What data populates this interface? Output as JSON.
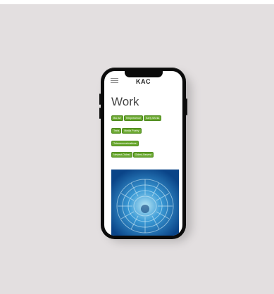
{
  "app": {
    "logo": "KAC"
  },
  "page": {
    "title": "Work"
  },
  "filters": {
    "tags": [
      "Bio Art",
      "Telepresence",
      "Early Works",
      "Texts",
      "Media Poetry",
      "Telecommunications"
    ],
    "sort": [
      "Newest-Oldest",
      "Oldest-Newest"
    ]
  },
  "colors": {
    "accent": "#6aa82f",
    "backdrop": "#e3dfe0",
    "artwork_blue": "#1565b5"
  },
  "icons": {
    "menu": "hamburger-menu-icon"
  }
}
